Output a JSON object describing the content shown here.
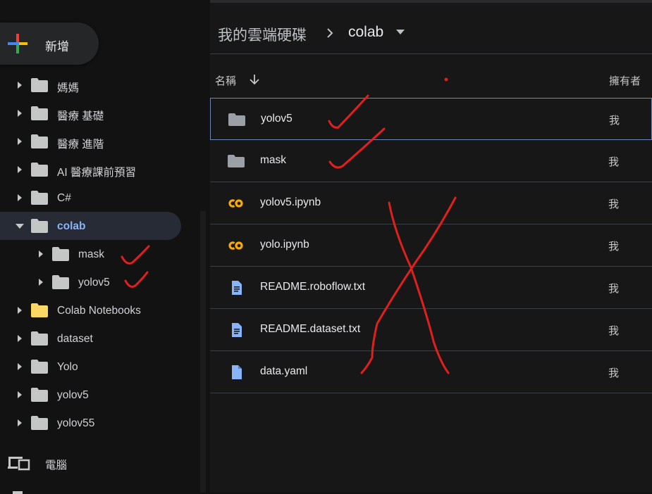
{
  "new_button": {
    "label": "新增"
  },
  "sidebar": {
    "items": [
      {
        "label": "媽媽",
        "level": 0,
        "expanded": false,
        "selected": false,
        "folder_color": "#c4c7c5"
      },
      {
        "label": "醫療 基礎",
        "level": 0,
        "expanded": false,
        "selected": false,
        "folder_color": "#c4c7c5"
      },
      {
        "label": "醫療 進階",
        "level": 0,
        "expanded": false,
        "selected": false,
        "folder_color": "#c4c7c5"
      },
      {
        "label": "AI 醫療課前預習",
        "level": 0,
        "expanded": false,
        "selected": false,
        "folder_color": "#c4c7c5"
      },
      {
        "label": "C#",
        "level": 0,
        "expanded": false,
        "selected": false,
        "folder_color": "#c4c7c5"
      },
      {
        "label": "colab",
        "level": 0,
        "expanded": true,
        "selected": true,
        "folder_color": "#c4c7c5"
      },
      {
        "label": "mask",
        "level": 1,
        "expanded": false,
        "selected": false,
        "folder_color": "#c4c7c5"
      },
      {
        "label": "yolov5",
        "level": 1,
        "expanded": false,
        "selected": false,
        "folder_color": "#c4c7c5"
      },
      {
        "label": "Colab Notebooks",
        "level": 0,
        "expanded": false,
        "selected": false,
        "folder_color": "#fdd663"
      },
      {
        "label": "dataset",
        "level": 0,
        "expanded": false,
        "selected": false,
        "folder_color": "#c4c7c5"
      },
      {
        "label": "Yolo",
        "level": 0,
        "expanded": false,
        "selected": false,
        "folder_color": "#c4c7c5"
      },
      {
        "label": "yolov5",
        "level": 0,
        "expanded": false,
        "selected": false,
        "folder_color": "#c4c7c5"
      },
      {
        "label": "yolov55",
        "level": 0,
        "expanded": false,
        "selected": false,
        "folder_color": "#c4c7c5"
      }
    ],
    "computers_label": "電腦"
  },
  "breadcrumb": {
    "root": "我的雲端硬碟",
    "current": "colab"
  },
  "columns": {
    "name": "名稱",
    "owner": "擁有者"
  },
  "files": [
    {
      "name": "yolov5",
      "owner": "我",
      "icon": "folder-icon",
      "focused": true
    },
    {
      "name": "mask",
      "owner": "我",
      "icon": "folder-icon",
      "focused": false
    },
    {
      "name": "yolov5.ipynb",
      "owner": "我",
      "icon": "colab-icon",
      "focused": false
    },
    {
      "name": "yolo.ipynb",
      "owner": "我",
      "icon": "colab-icon",
      "focused": false
    },
    {
      "name": "README.roboflow.txt",
      "owner": "我",
      "icon": "doc-icon",
      "focused": false
    },
    {
      "name": "README.dataset.txt",
      "owner": "我",
      "icon": "doc-icon",
      "focused": false
    },
    {
      "name": "data.yaml",
      "owner": "我",
      "icon": "file-icon",
      "focused": false
    }
  ],
  "colors": {
    "background": "#121212",
    "accent": "#8ab4f8",
    "annotation": "#e0201e",
    "colab": "#f9ab00",
    "doc": "#8ab4f8"
  }
}
